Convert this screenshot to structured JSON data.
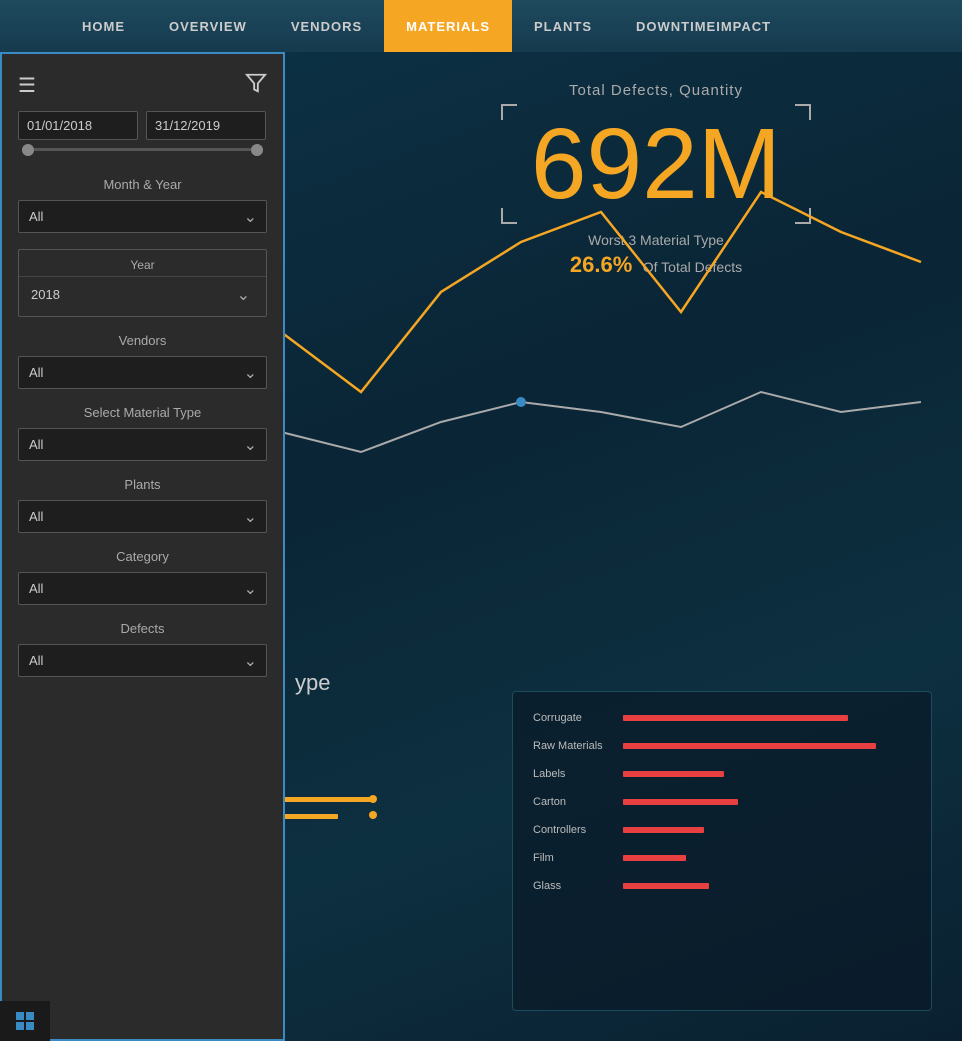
{
  "nav": {
    "items": [
      {
        "label": "Home",
        "active": false
      },
      {
        "label": "Overview",
        "active": false
      },
      {
        "label": "Vendors",
        "active": false
      },
      {
        "label": "Materials",
        "active": true
      },
      {
        "label": "Plants",
        "active": false
      },
      {
        "label": "DowntimeImpact",
        "active": false
      }
    ]
  },
  "stat": {
    "label": "Total Defects, Quantity",
    "number": "692M",
    "worst_label": "Worst 3 Material Type",
    "pct": "26.6%",
    "pct_text": "Of Total Defects"
  },
  "sidebar": {
    "date_start": "01/01/2018",
    "date_end": "31/12/2019",
    "month_year_label": "Month & Year",
    "month_year_value": "All",
    "year_label": "Year",
    "year_value": "2018",
    "vendors_label": "Vendors",
    "vendors_value": "All",
    "material_type_label": "Select Material Type",
    "material_type_value": "All",
    "plants_label": "Plants",
    "plants_value": "All",
    "category_label": "Category",
    "category_value": "All",
    "defects_label": "Defects",
    "defects_value": "All",
    "all_option": "All"
  },
  "bar_chart": {
    "items": [
      {
        "label": "Corrugate",
        "pct": 78
      },
      {
        "label": "Raw Materials",
        "pct": 88
      },
      {
        "label": "Labels",
        "pct": 35
      },
      {
        "label": "Carton",
        "pct": 40
      },
      {
        "label": "Controllers",
        "pct": 28
      },
      {
        "label": "Film",
        "pct": 22
      },
      {
        "label": "Glass",
        "pct": 30
      }
    ]
  },
  "type_label": "ype",
  "yellow_bars": [
    {
      "width": 80
    },
    {
      "width": 50
    }
  ],
  "icons": {
    "hamburger": "☰",
    "filter": "⛉",
    "chevron_down": "⌄"
  }
}
